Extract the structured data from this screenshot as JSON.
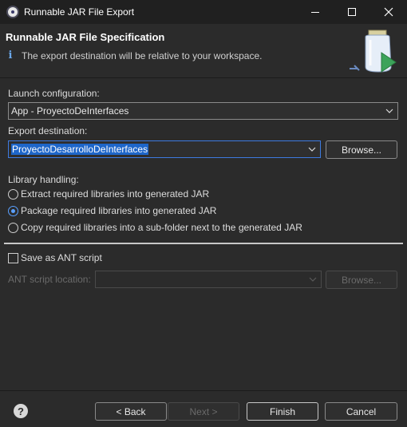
{
  "window": {
    "title": "Runnable JAR File Export"
  },
  "header": {
    "title": "Runnable JAR File Specification",
    "message": "The export destination will be relative to your workspace."
  },
  "launch": {
    "label": "Launch configuration:",
    "value": "App - ProyectoDeInterfaces"
  },
  "export": {
    "label": "Export destination:",
    "value": "ProyectoDesarrolloDeInterfaces",
    "browse_label": "Browse..."
  },
  "library": {
    "label": "Library handling:",
    "options": [
      {
        "label": "Extract required libraries into generated JAR",
        "checked": false
      },
      {
        "label": "Package required libraries into generated JAR",
        "checked": true
      },
      {
        "label": "Copy required libraries into a sub-folder next to the generated JAR",
        "checked": false
      }
    ]
  },
  "ant": {
    "save_label": "Save as ANT script",
    "save_checked": false,
    "location_label": "ANT script location:",
    "location_value": "",
    "browse_label": "Browse..."
  },
  "footer": {
    "back_label": "< Back",
    "next_label": "Next >",
    "finish_label": "Finish",
    "cancel_label": "Cancel"
  }
}
